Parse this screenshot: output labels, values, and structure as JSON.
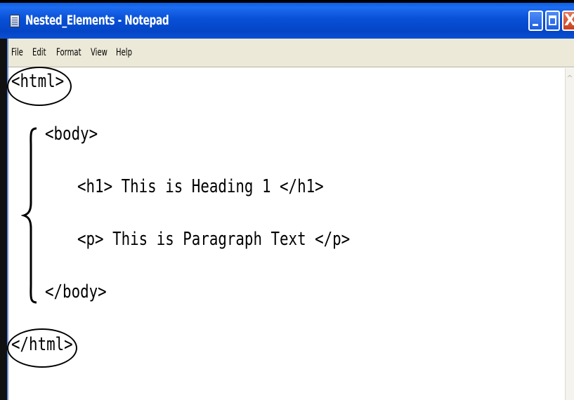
{
  "window": {
    "title": "Nested_Elements - Notepad",
    "close_glyph": "X"
  },
  "menu": [
    "File",
    "Edit",
    "Format",
    "View",
    "Help"
  ],
  "editor": {
    "lines": [
      "<html>",
      "<body>",
      "<h1> This is Heading 1 </h1>",
      "<p> This is Paragraph Text </p>",
      "</body>",
      "</html>"
    ]
  },
  "colors": {
    "titlebar": "#0450d6",
    "menubar": "#ece9d8",
    "close_button": "#d04a25"
  },
  "icons": {
    "app": "notepad-icon",
    "minimize": "minimize-icon",
    "maximize": "maximize-icon",
    "close": "close-icon"
  }
}
